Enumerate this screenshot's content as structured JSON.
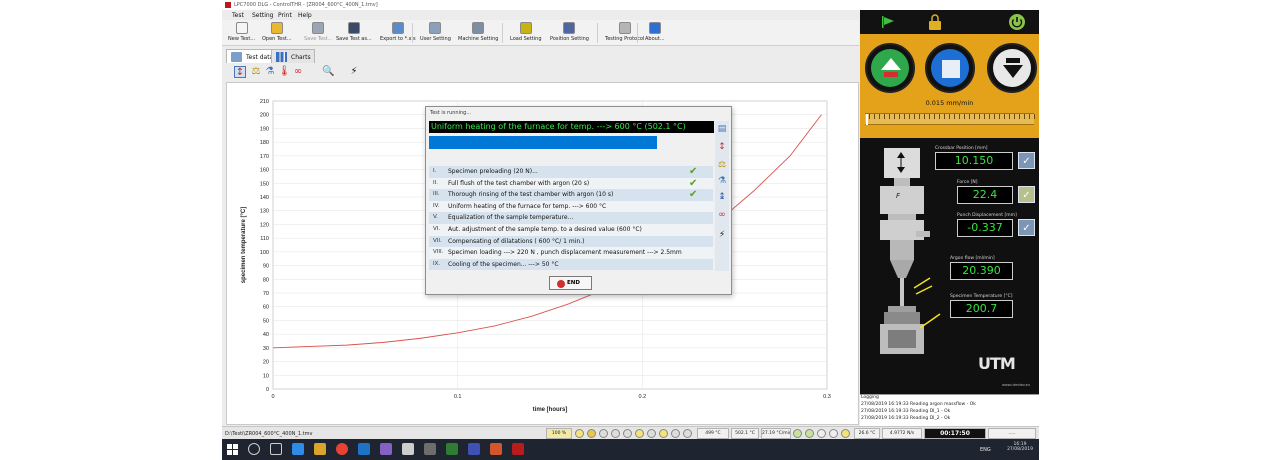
{
  "window": {
    "title": "LPC7000 DLG - ControlTHR - [ZR004_600°C_400N_1.tmv]"
  },
  "menu": [
    "Test",
    "Setting",
    "Print",
    "Help"
  ],
  "toolbar": [
    {
      "label": "New Test...",
      "icon": "new-document-icon",
      "color": "#f5f5f5",
      "disabled": false
    },
    {
      "label": "Open Test...",
      "icon": "open-folder-icon",
      "color": "#e9b730",
      "disabled": false
    },
    {
      "label": "Save Test...",
      "icon": "save-icon",
      "color": "#9aa6b3",
      "disabled": true
    },
    {
      "label": "Save Test as...",
      "icon": "save-as-icon",
      "color": "#3a4a6b",
      "disabled": false
    },
    {
      "label": "Export to *.xls",
      "icon": "export-icon",
      "color": "#5b8bc9",
      "disabled": false
    },
    {
      "label": "User Setting",
      "icon": "user-setting-icon",
      "color": "#8aa0bd",
      "disabled": false
    },
    {
      "label": "Machine Setting",
      "icon": "machine-setting-icon",
      "color": "#7e8fa5",
      "disabled": false
    },
    {
      "label": "Load Setting",
      "icon": "load-setting-icon",
      "color": "#c7b312",
      "disabled": false
    },
    {
      "label": "Position Setting",
      "icon": "position-setting-icon",
      "color": "#4f66a3",
      "disabled": false
    },
    {
      "label": "Testing Protocol",
      "icon": "testing-protocol-icon",
      "color": "#b5b5b5",
      "disabled": false
    },
    {
      "label": "About...",
      "icon": "about-icon",
      "color": "#2f6fd1",
      "disabled": false
    }
  ],
  "tabs": [
    {
      "label": "Test data",
      "icon": "test-data-icon"
    },
    {
      "label": "Charts",
      "icon": "charts-icon"
    }
  ],
  "chart_data": {
    "type": "line",
    "xlabel": "time [hours]",
    "ylabel": "specimen temperature [°C]",
    "xlim": [
      0,
      0.3
    ],
    "ylim": [
      0,
      210
    ],
    "xticks": [
      "0",
      "0.1",
      "0.2",
      "0.3"
    ],
    "yticks": [
      "0",
      "10",
      "20",
      "30",
      "40",
      "50",
      "60",
      "70",
      "80",
      "90",
      "100",
      "110",
      "120",
      "130",
      "140",
      "150",
      "160",
      "170",
      "180",
      "190",
      "200",
      "210"
    ],
    "grid": true,
    "series": [
      {
        "color": "#d9534f",
        "x": [
          0,
          0.02,
          0.04,
          0.06,
          0.08,
          0.1,
          0.12,
          0.14,
          0.16,
          0.18,
          0.2,
          0.22,
          0.24,
          0.26,
          0.28,
          0.297
        ],
        "y": [
          30,
          31,
          32,
          34,
          37,
          41,
          46,
          53,
          62,
          73,
          86,
          102,
          121,
          144,
          170,
          200
        ]
      }
    ]
  },
  "dialog": {
    "title": "Test is running...",
    "banner": "Uniform heating of the furnace for temp. ---> 600 °C (502.1 °C)",
    "progress": 0.8,
    "steps": [
      {
        "num": "I.",
        "text": "Specimen preloading (20 N)...",
        "done": true
      },
      {
        "num": "II.",
        "text": "Full flush of the test chamber with argon (20 s)",
        "done": true
      },
      {
        "num": "III.",
        "text": "Thorough rinsing of the test chamber with argon (10 s)",
        "done": true
      },
      {
        "num": "IV.",
        "text": "Uniform heating of the furnace for temp. ---> 600 °C",
        "done": false
      },
      {
        "num": "V.",
        "text": "Equalization of the sample temperature...",
        "done": false
      },
      {
        "num": "VI.",
        "text": "Aut. adjustment of the sample temp. to a desired value (600 °C)",
        "done": false
      },
      {
        "num": "VII.",
        "text": "Compensating of dilatations ( 600 °C/ 1 min.)",
        "done": false
      },
      {
        "num": "VIII.",
        "text": "Specimen loading ---> 220 N , punch displacement measurement ---> 2.5mm",
        "done": false
      },
      {
        "num": "IX.",
        "text": "Cooling of the specimen... ---> 50 °C",
        "done": false
      }
    ],
    "end_label": "END"
  },
  "status": {
    "path": "D:\\Testi\\ZR004_600°C_400N_1.tmv",
    "zoom": "100 %",
    "temp1": "499 °C",
    "temp2": "502.1 °C",
    "rate": "27.19 °C/min",
    "temp3": "26.6 °C",
    "flow": "4.9772 N/s",
    "timer": "00:17:50",
    "extra": "....."
  },
  "right": {
    "speed": "0.015 mm/min",
    "crossbar_label": "Crossbar Position [mm]",
    "crossbar": "10.150",
    "force_label": "Force [N]",
    "force": "22.4",
    "punch_label": "Punch Displacement [mm]",
    "punch": "-0.337",
    "argon_label": "Argon flow [ml/min]",
    "argon": "20.390",
    "spec_label": "Specimen Temperature [°C]",
    "spec": "200.7",
    "force_marker": "F",
    "logo": "UTM",
    "logo_sub": "www.utmdev.eu"
  },
  "logging": {
    "title": "Logging",
    "lines": [
      "27/08/2019 16:19:33 Reading argon massflow - Ok",
      "27/08/2019 16:19:33 Reading DI_1 - Ok",
      "27/08/2019 16:19:33 Reading DI_2 - Ok"
    ]
  },
  "taskbar": {
    "time": "16:19",
    "date": "27/08/2019",
    "lang": "ENG"
  }
}
